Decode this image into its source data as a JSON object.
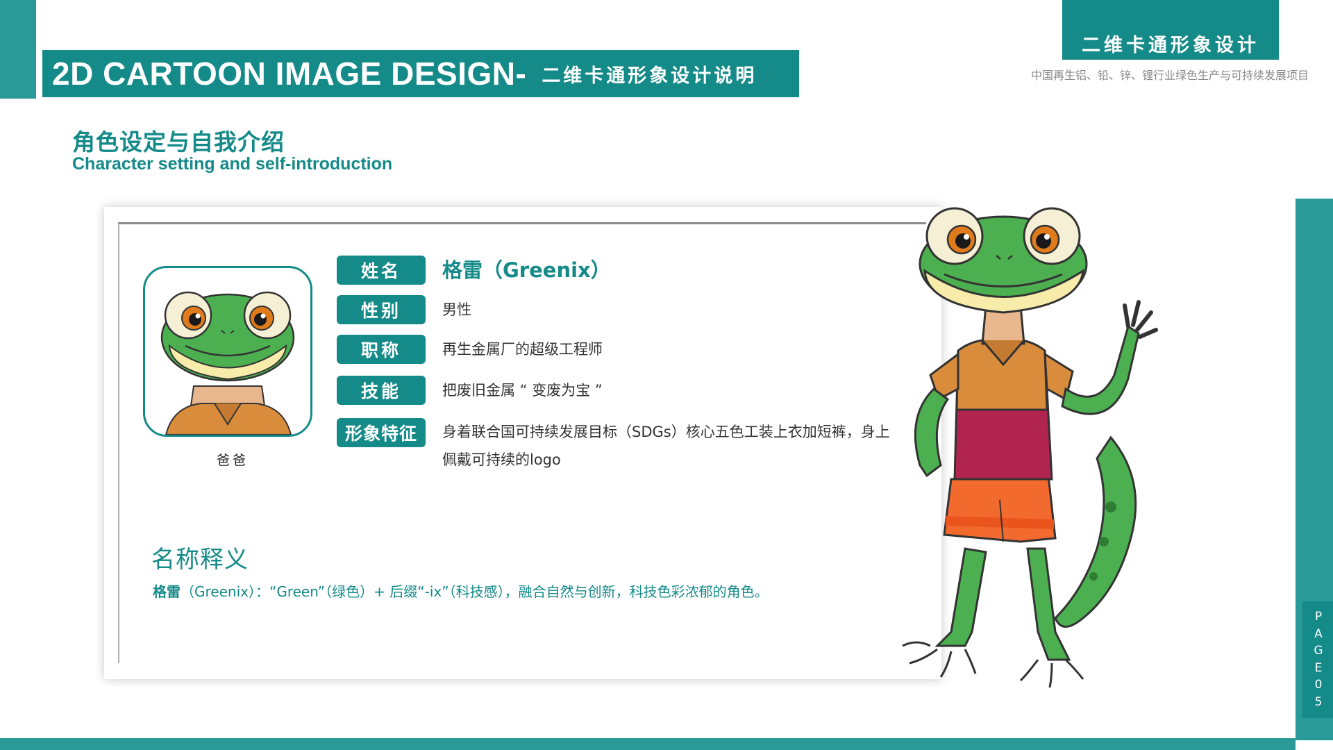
{
  "header": {
    "banner_en": "2D CARTOON IMAGE DESIGN-",
    "banner_cn": "二维卡通形象设计说明",
    "tab_title": "二维卡通形象设计",
    "project": "中国再生铝、铅、锌、锂行业绿色生产与可持续发展项目"
  },
  "section": {
    "title_cn": "角色设定与自我介绍",
    "title_en": "Character setting and self-introduction"
  },
  "profile": {
    "avatar_label": "爸爸",
    "rows": [
      {
        "tag": "姓名",
        "value": "格雷（Greenix）"
      },
      {
        "tag": "性别",
        "value": "男性"
      },
      {
        "tag": "职称",
        "value": "再生金属厂的超级工程师"
      },
      {
        "tag": "技能",
        "value": "把废旧金属 “ 变废为宝 ”"
      },
      {
        "tag": "形象特征",
        "value": "身着联合国可持续发展目标（SDGs）核心五色工装上衣加短裤，身上佩戴可持续的logo"
      }
    ]
  },
  "meaning": {
    "title": "名称释义",
    "name_bold": "格雷",
    "text": "（Greenix）：“Green”（绿色）+ 后缀“-ix”（科技感），融合自然与创新，科技色彩浓郁的角色。"
  },
  "page_label": [
    "P",
    "A",
    "G",
    "E",
    "0",
    "5"
  ],
  "colors": {
    "primary_teal": "#148a89",
    "accent_teal": "#2a9a99",
    "gecko_green": "#4caf50",
    "shirt_orange": "#d98d3c",
    "shirt_magenta": "#b0244f",
    "shorts_orange": "#f26a2e"
  }
}
